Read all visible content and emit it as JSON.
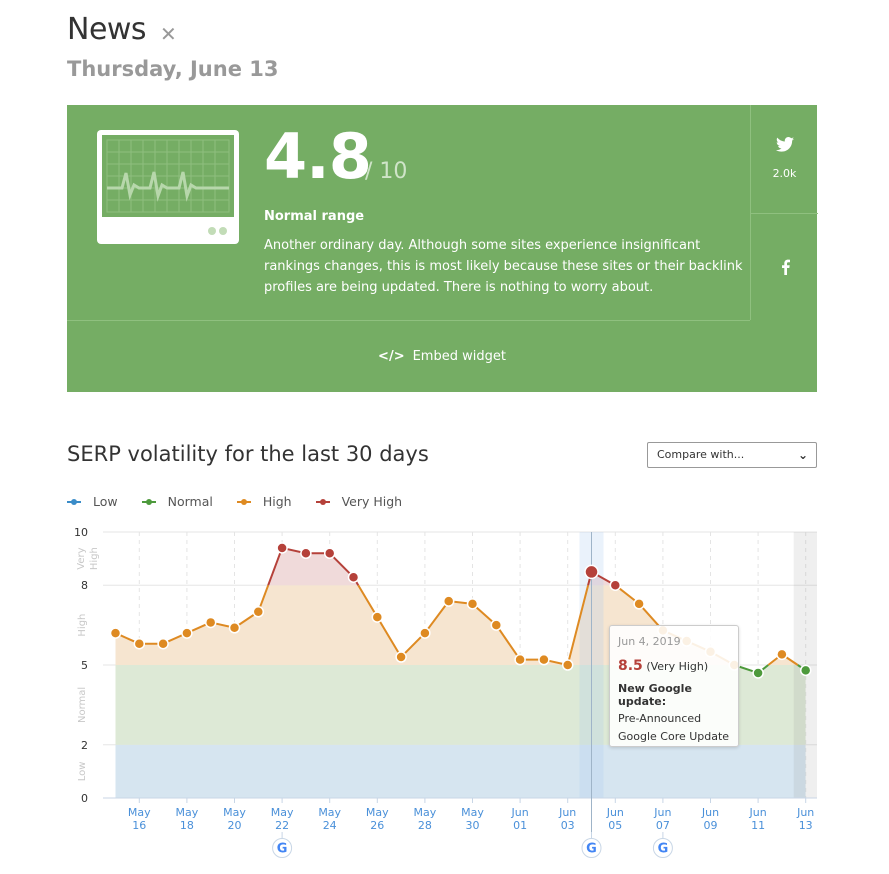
{
  "header": {
    "title": "News",
    "close_icon": "close-icon",
    "date": "Thursday, June 13"
  },
  "score_card": {
    "score": "4.8",
    "out_of": "/ 10",
    "range_label": "Normal range",
    "description": "Another ordinary day. Although some sites experience insignificant rankings changes, this is most likely because these sites or their backlink profiles are being updated. There is nothing to worry about.",
    "icon": "heart-monitor-icon",
    "twitter_count": "2.0k",
    "embed_label": "Embed widget",
    "embed_icon": "code-icon",
    "colors": {
      "background": "#75ad64"
    }
  },
  "section": {
    "title": "SERP volatility for the last 30 days",
    "compare_placeholder": "Compare with..."
  },
  "tooltip": {
    "date": "Jun 4, 2019",
    "value": "8.5",
    "level": "(Very High)",
    "update_title": "New Google update:",
    "update_line1": "Pre-Announced",
    "update_line2": "Google Core Update"
  },
  "chart_data": {
    "type": "line",
    "title": "SERP volatility for the last 30 days",
    "xlabel": "",
    "ylabel": "",
    "ylim": [
      0,
      10
    ],
    "yticks": [
      0,
      2,
      5,
      8,
      10
    ],
    "bands": [
      {
        "name": "Low",
        "from": 0,
        "to": 2,
        "color": "#d6e5f0"
      },
      {
        "name": "Normal",
        "from": 2,
        "to": 5,
        "color": "#dde9d6"
      },
      {
        "name": "High",
        "from": 5,
        "to": 8,
        "color": "#f6e5d0"
      },
      {
        "name": "Very High",
        "from": 8,
        "to": 10,
        "color": "#f0dada"
      }
    ],
    "band_labels": [
      "Low",
      "Normal",
      "High",
      "Very High"
    ],
    "legend": [
      {
        "name": "Low",
        "color": "#3a8cc8"
      },
      {
        "name": "Normal",
        "color": "#4d9a3c"
      },
      {
        "name": "High",
        "color": "#de8a22"
      },
      {
        "name": "Very High",
        "color": "#b5413a"
      }
    ],
    "legend_position": "top-left",
    "grid": true,
    "dates": [
      "May 15",
      "May 16",
      "May 17",
      "May 18",
      "May 19",
      "May 20",
      "May 21",
      "May 22",
      "May 23",
      "May 24",
      "May 25",
      "May 26",
      "May 27",
      "May 28",
      "May 29",
      "May 30",
      "May 31",
      "Jun 01",
      "Jun 02",
      "Jun 03",
      "Jun 04",
      "Jun 05",
      "Jun 06",
      "Jun 07",
      "Jun 08",
      "Jun 09",
      "Jun 10",
      "Jun 11",
      "Jun 12",
      "Jun 13"
    ],
    "x_tick_labels": [
      {
        "index": 1,
        "line1": "May",
        "line2": "16"
      },
      {
        "index": 3,
        "line1": "May",
        "line2": "18"
      },
      {
        "index": 5,
        "line1": "May",
        "line2": "20"
      },
      {
        "index": 7,
        "line1": "May",
        "line2": "22"
      },
      {
        "index": 9,
        "line1": "May",
        "line2": "24"
      },
      {
        "index": 11,
        "line1": "May",
        "line2": "26"
      },
      {
        "index": 13,
        "line1": "May",
        "line2": "28"
      },
      {
        "index": 15,
        "line1": "May",
        "line2": "30"
      },
      {
        "index": 17,
        "line1": "Jun",
        "line2": "01"
      },
      {
        "index": 19,
        "line1": "Jun",
        "line2": "03"
      },
      {
        "index": 21,
        "line1": "Jun",
        "line2": "05"
      },
      {
        "index": 23,
        "line1": "Jun",
        "line2": "07"
      },
      {
        "index": 25,
        "line1": "Jun",
        "line2": "09"
      },
      {
        "index": 27,
        "line1": "Jun",
        "line2": "11"
      },
      {
        "index": 29,
        "line1": "Jun",
        "line2": "13"
      }
    ],
    "series": [
      {
        "name": "SERP volatility",
        "values": [
          6.2,
          5.8,
          5.8,
          6.2,
          6.6,
          6.4,
          7.0,
          9.4,
          9.2,
          9.2,
          8.3,
          6.8,
          5.3,
          6.2,
          7.4,
          7.3,
          6.5,
          5.2,
          5.2,
          5.0,
          8.5,
          8.0,
          7.3,
          6.3,
          5.9,
          5.5,
          5.0,
          4.7,
          5.4,
          4.8
        ]
      }
    ],
    "google_updates": [
      7,
      20,
      23
    ],
    "selected_index": 20,
    "shaded_index": 29
  }
}
